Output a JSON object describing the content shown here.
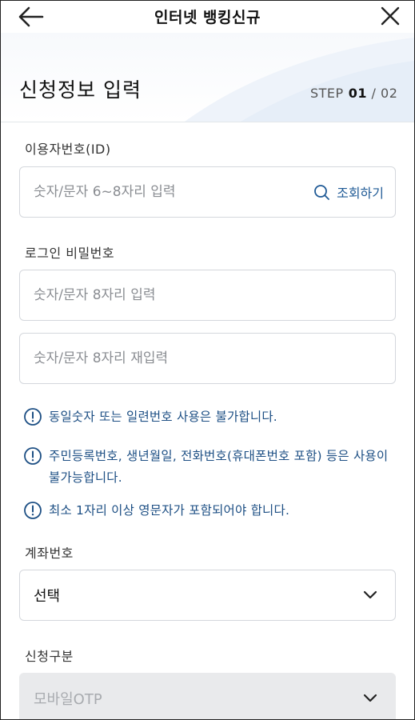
{
  "header": {
    "title": "인터넷 뱅킹신규",
    "back_icon": "arrow-left-icon",
    "close_icon": "close-icon"
  },
  "banner": {
    "page_title": "신청정보 입력",
    "step_label": "STEP",
    "step_current": "01",
    "step_total": "/ 02"
  },
  "user_id": {
    "label": "이용자번호(ID)",
    "placeholder": "숫자/문자 6~8자리 입력",
    "value": "",
    "lookup_label": "조회하기",
    "lookup_icon": "search-icon"
  },
  "password": {
    "label": "로그인 비밀번호",
    "placeholder": "숫자/문자 8자리 입력",
    "confirm_placeholder": "숫자/문자 8자리 재입력"
  },
  "notices": [
    {
      "icon": "info-icon",
      "text": "동일숫자 또는 일련번호 사용은 불가합니다."
    },
    {
      "icon": "info-icon",
      "text": "주민등록번호, 생년월일, 전화번호(휴대폰번호 포함) 등은 사용이 불가능합니다."
    },
    {
      "icon": "info-icon",
      "text": "최소 1자리 이상 영문자가 포함되어야 합니다."
    }
  ],
  "account": {
    "label": "계좌번호",
    "selected": "선택",
    "chevron_icon": "chevron-down-icon"
  },
  "request_type": {
    "label": "신청구분",
    "selected": "모바일OTP",
    "disabled": true,
    "chevron_icon": "chevron-down-icon"
  },
  "colors": {
    "accent": "#1f5a96",
    "notice_text": "#1d4f84",
    "border": "#d4d7dc",
    "disabled_bg": "#e9eaec"
  }
}
